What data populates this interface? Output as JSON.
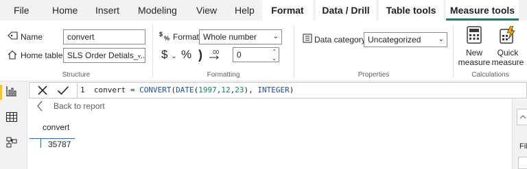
{
  "menu": {
    "tabs": [
      "File",
      "Home",
      "Insert",
      "Modeling",
      "View",
      "Help"
    ],
    "context_tabs": [
      "Format",
      "Data / Drill",
      "Table tools",
      "Measure tools"
    ],
    "active_tab": "Measure tools"
  },
  "structure": {
    "name_label": "Name",
    "name_value": "convert",
    "home_table_label": "Home table",
    "home_table_value": "SLS Order Detials_...",
    "group_title": "Structure"
  },
  "formatting": {
    "format_label": "Format",
    "format_value": "Whole number",
    "currency_symbol": "$",
    "percent_symbol": "%",
    "comma_symbol": ")",
    "decimal_symbol": ".00",
    "decimals_value": "0",
    "group_title": "Formatting"
  },
  "properties": {
    "data_category_label": "Data category",
    "data_category_value": "Uncategorized",
    "group_title": "Properties"
  },
  "calculations": {
    "new_measure_line1": "New",
    "new_measure_line2": "measure",
    "quick_measure_line1": "Quick",
    "quick_measure_line2": "measure",
    "group_title": "Calculations"
  },
  "formula_bar": {
    "line_number": "1",
    "measure_name": "convert",
    "equals": "=",
    "fn_convert": "CONVERT",
    "fn_date": "DATE",
    "year": "1997",
    "month": "12",
    "day": "23",
    "type_arg": "INTEGER"
  },
  "canvas": {
    "back_label": "Back to report",
    "column_header": "convert",
    "cell_value": "35787",
    "right_pane_text": "Fil"
  },
  "colors": {
    "active_tab_underline": "#1a7f5f",
    "active_view_marker": "#f2c811",
    "function_blue": "#1a4bb4",
    "number_green": "#098658",
    "calculator_icon": "#3b3a39",
    "quick_measure_accent": "#f2a900"
  },
  "icons": {
    "name": "name-tag-icon",
    "home_table": "home-icon",
    "format": "format-dollar-percent-icon",
    "cancel": "close-x-icon",
    "commit": "checkmark-icon",
    "back": "chevron-left-icon",
    "report_view": "bar-chart-icon",
    "data_view": "table-grid-icon",
    "model_view": "model-icon"
  }
}
